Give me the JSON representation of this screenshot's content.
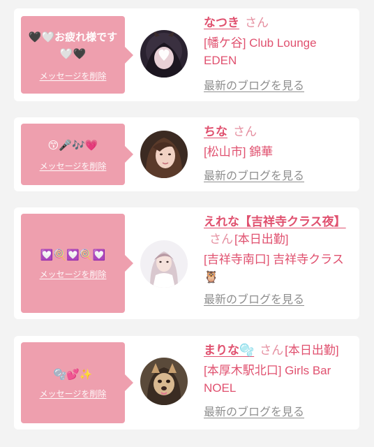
{
  "items": [
    {
      "message": "🖤🤍お疲れ様です🤍🖤",
      "delete_label": "メッセージを削除",
      "name": "なつき",
      "honorific": "さん",
      "status": "",
      "shop": "[幡ケ谷] Club Lounge EDEN",
      "blog_label": "最新のブログを見る"
    },
    {
      "message": "😙🎤🎶💗",
      "delete_label": "メッセージを削除",
      "name": "ちな",
      "honorific": "さん",
      "status": "",
      "shop": "[松山市] 錦華",
      "blog_label": "最新のブログを見る"
    },
    {
      "message": "💟🍭💟🍭💟",
      "delete_label": "メッセージを削除",
      "name": "えれな【吉祥寺クラス夜】",
      "honorific": "さん",
      "status": "[本日出勤]",
      "shop": "[吉祥寺南口] 吉祥寺クラス🦉",
      "blog_label": "最新のブログを見る"
    },
    {
      "message": "🫧💕✨",
      "delete_label": "メッセージを削除",
      "name": "まりな🫧",
      "honorific": "さん",
      "status": "[本日出勤]",
      "shop": "[本厚木駅北口] Girls Bar NOEL",
      "blog_label": "最新のブログを見る"
    }
  ],
  "colors": {
    "accent": "#e0516f",
    "bubble": "#ee9fae",
    "link_gray": "#8e8e8e",
    "background": "#f3f3f3"
  }
}
